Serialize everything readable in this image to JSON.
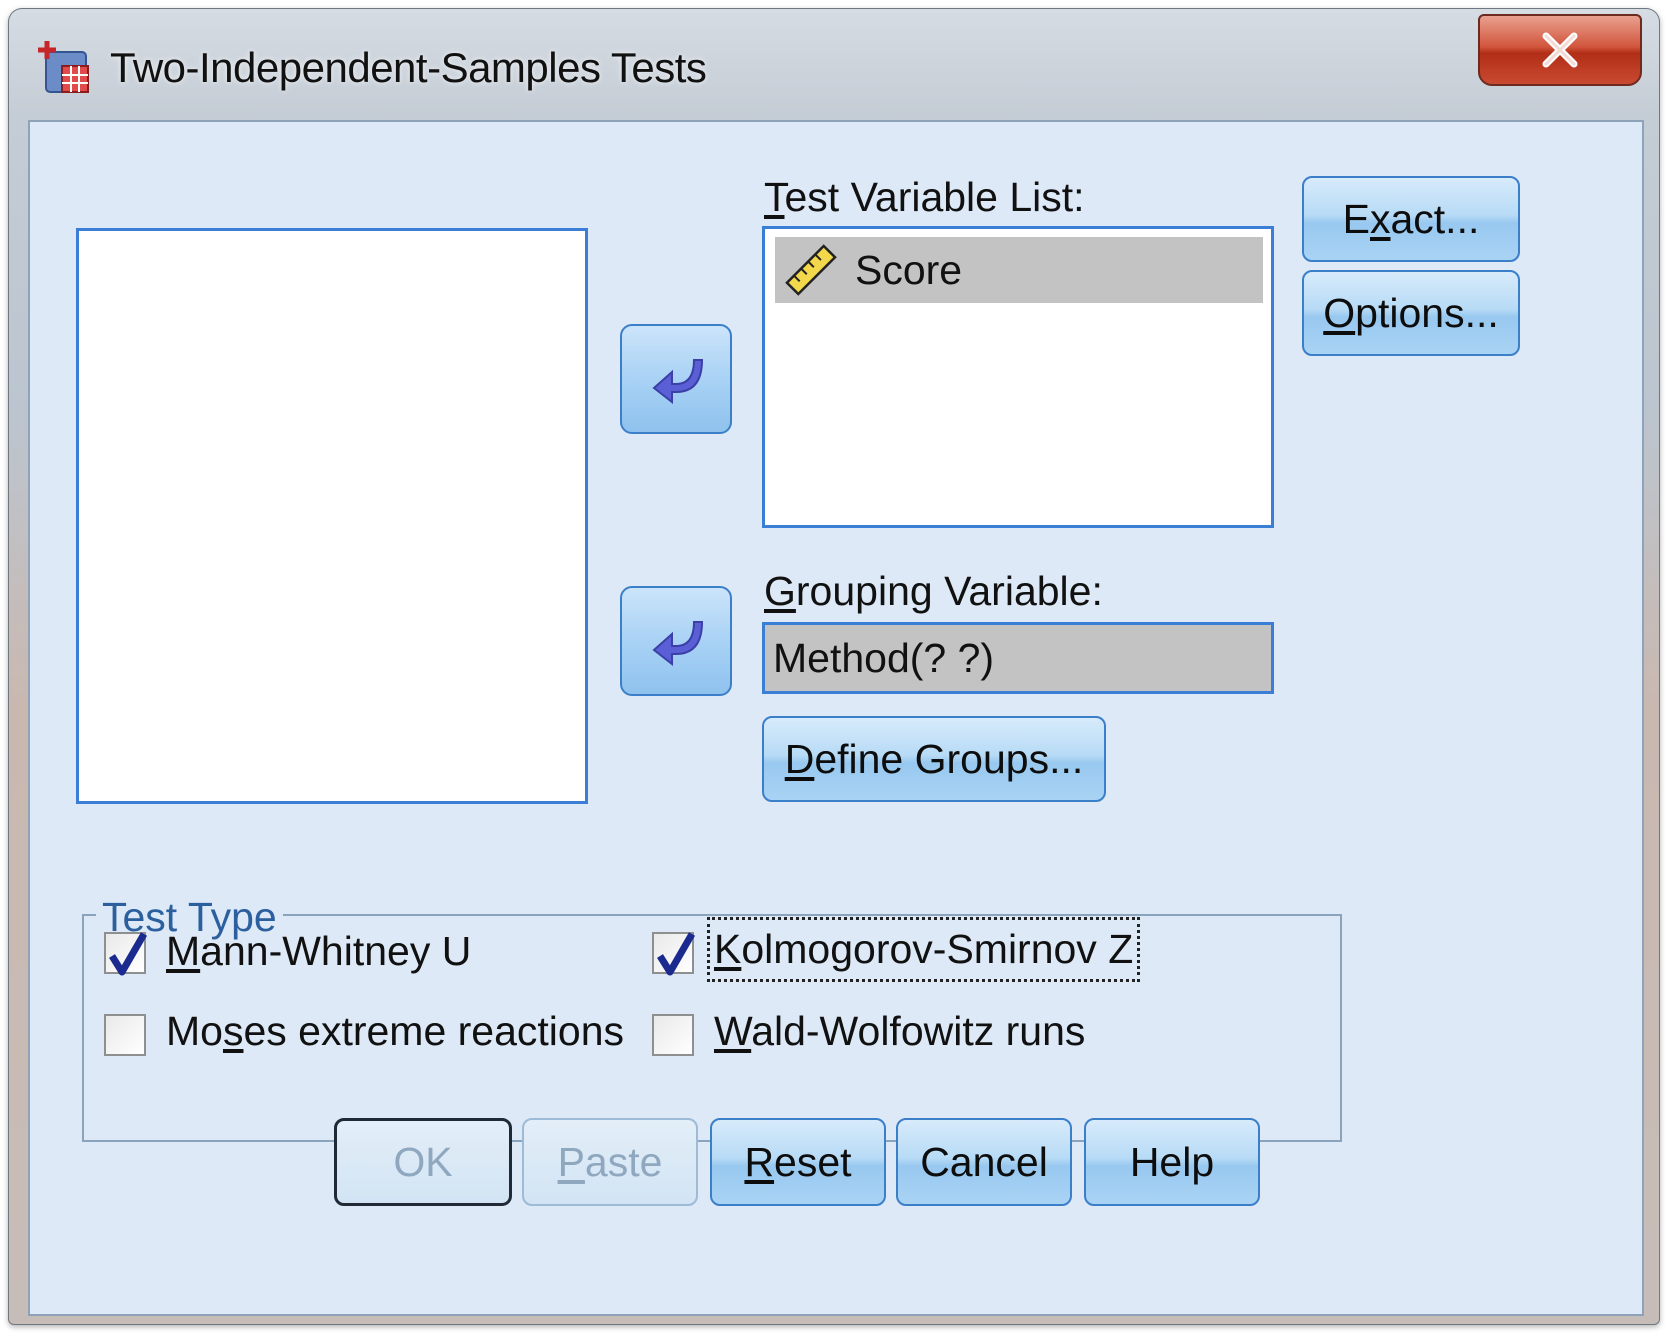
{
  "window": {
    "title": "Two-Independent-Samples Tests",
    "close_label": "X"
  },
  "test_variable_list": {
    "label_pre": "",
    "label_ul": "T",
    "label_post": "est Variable List:",
    "items": [
      {
        "label": "Score",
        "icon": "ruler-icon"
      }
    ]
  },
  "grouping_variable": {
    "label_ul": "G",
    "label_post": "rouping Variable:",
    "value": "Method(? ?)"
  },
  "buttons": {
    "exact": {
      "pre": "E",
      "ul": "x",
      "post": "act..."
    },
    "options": {
      "pre": "",
      "ul": "O",
      "post": "ptions..."
    },
    "define_groups": {
      "pre": "",
      "ul": "D",
      "post": "efine Groups..."
    },
    "ok": "OK",
    "paste": {
      "pre": "",
      "ul": "P",
      "post": "aste"
    },
    "reset": {
      "pre": "",
      "ul": "R",
      "post": "eset"
    },
    "cancel": "Cancel",
    "help": "Help"
  },
  "test_type": {
    "title": "Test Type",
    "mann_whitney": {
      "pre": "",
      "ul": "M",
      "post": "ann-Whitney U",
      "checked": true
    },
    "kolmogorov": {
      "pre": "",
      "ul": "K",
      "post": "olmogorov-Smirnov Z",
      "checked": true
    },
    "moses": {
      "pre": "Mo",
      "ul": "s",
      "post": "es extreme reactions",
      "checked": false
    },
    "wald": {
      "pre": "",
      "ul": "W",
      "post": "ald-Wolfowitz runs",
      "checked": false
    }
  },
  "colors": {
    "client_bg": "#dde9f7",
    "accent_border": "#3a7fd5",
    "arrow": "#5b5fd6",
    "selection": "#c3c3c3"
  }
}
